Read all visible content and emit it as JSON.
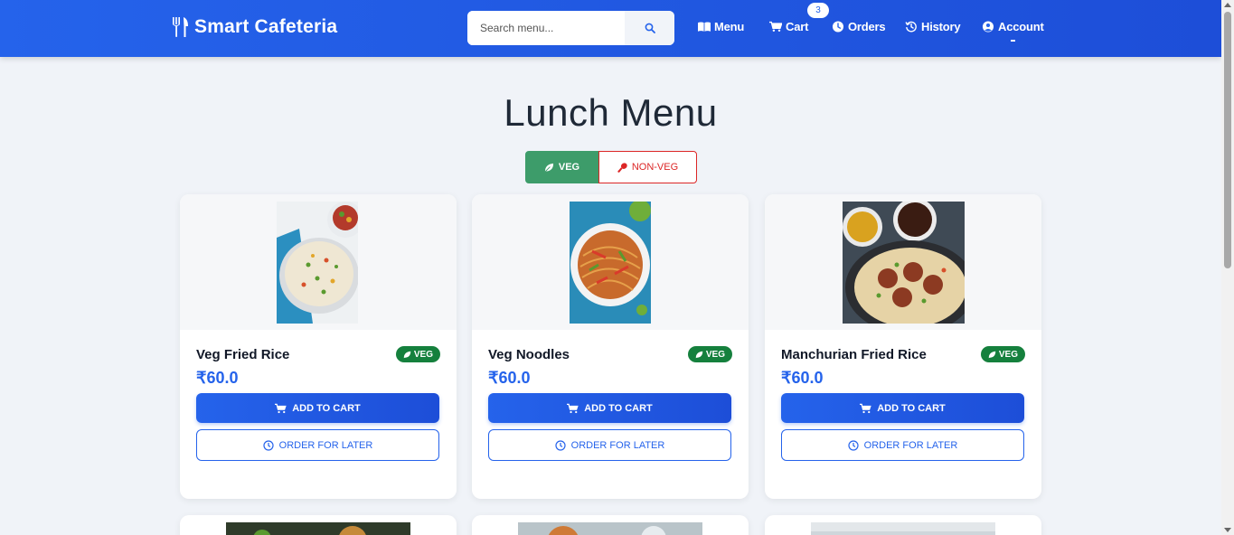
{
  "brand": {
    "name": "Smart Cafeteria"
  },
  "search": {
    "placeholder": "Search menu..."
  },
  "nav": {
    "menu": "Menu",
    "cart": "Cart",
    "cart_count": "3",
    "orders": "Orders",
    "history": "History",
    "account": "Account"
  },
  "page": {
    "title": "Lunch Menu"
  },
  "filter": {
    "veg": "VEG",
    "nonveg": "NON-VEG",
    "active": "veg"
  },
  "items": [
    {
      "name": "Veg Fried Rice",
      "badge": "VEG",
      "price": "₹60.0",
      "add_label": "ADD TO CART",
      "later_label": "ORDER FOR LATER"
    },
    {
      "name": "Veg Noodles",
      "badge": "VEG",
      "price": "₹60.0",
      "add_label": "ADD TO CART",
      "later_label": "ORDER FOR LATER"
    },
    {
      "name": "Manchurian Fried Rice",
      "badge": "VEG",
      "price": "₹60.0",
      "add_label": "ADD TO CART",
      "later_label": "ORDER FOR LATER"
    }
  ],
  "colors": {
    "primary": "#2563eb",
    "veg": "#15803d",
    "nonveg": "#dc2626",
    "background": "#f0f3f8"
  }
}
